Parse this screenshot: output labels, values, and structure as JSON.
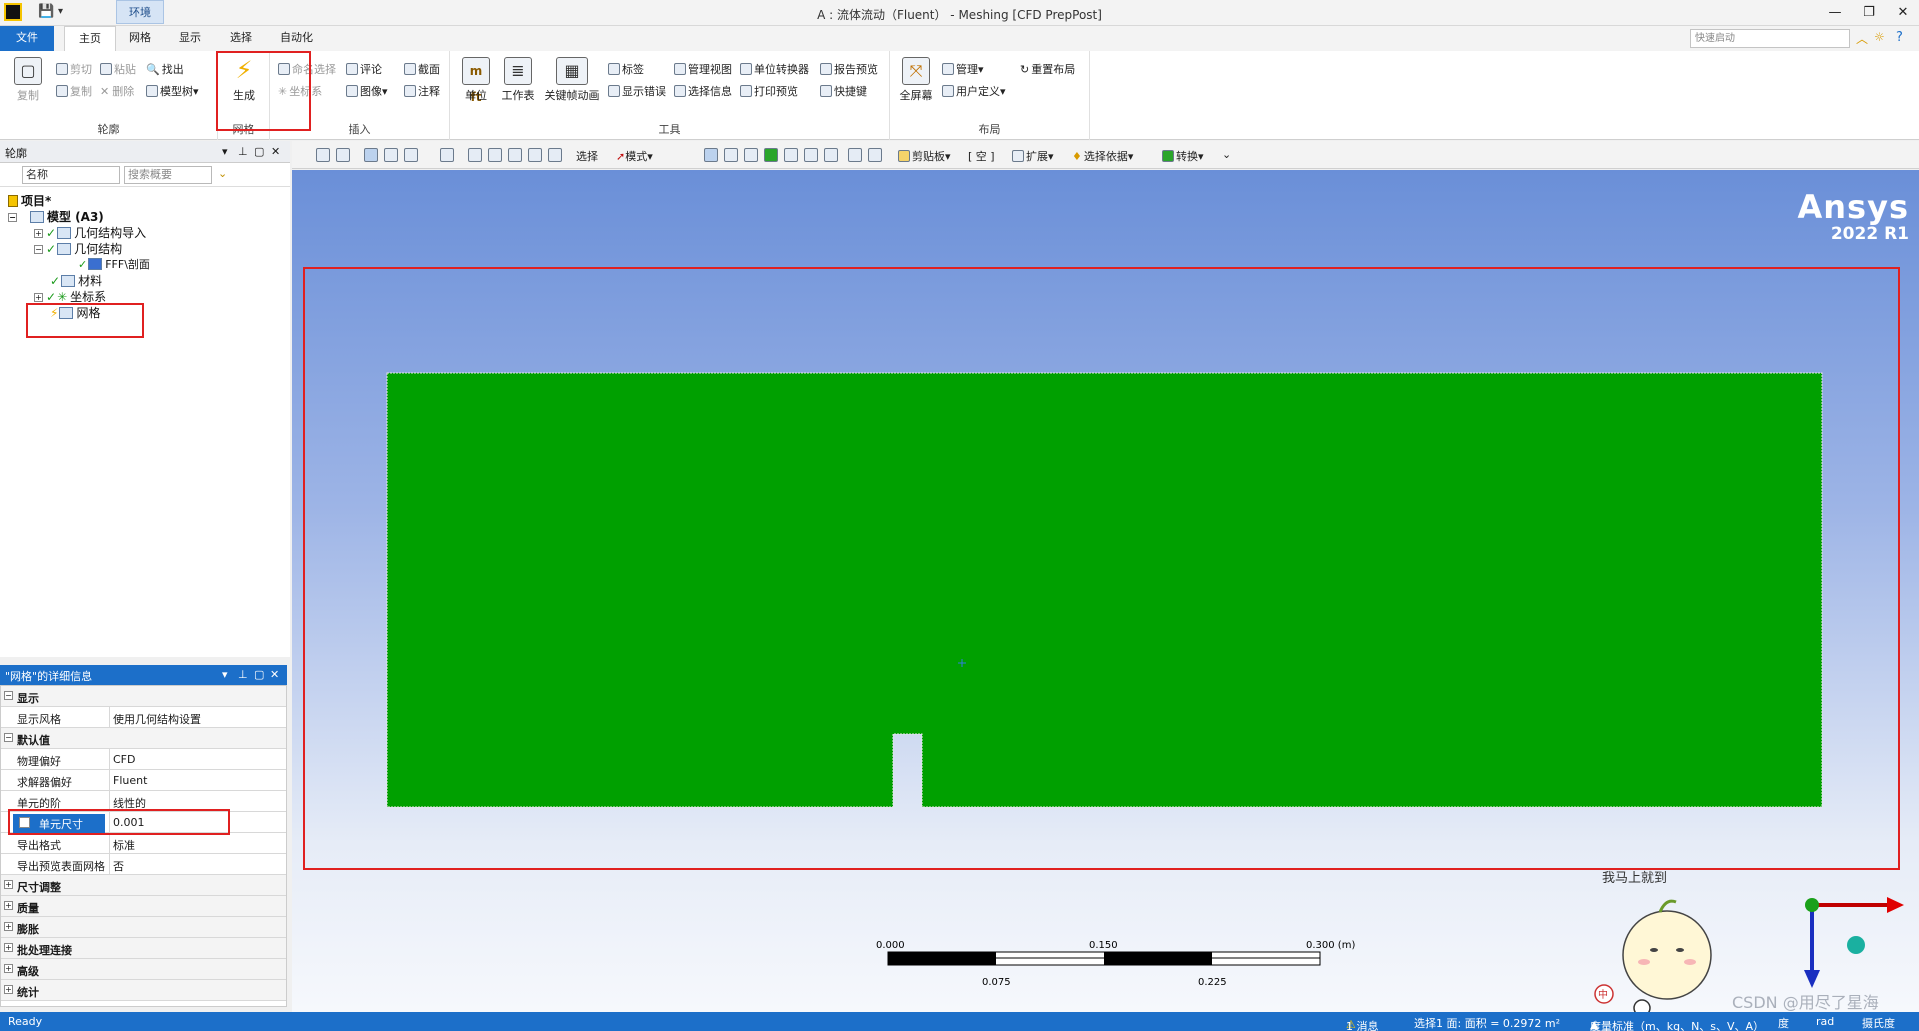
{
  "window": {
    "title": "A : 流体流动（Fluent） - Meshing [CFD PrepPost]",
    "context_tab": "环境",
    "controls": [
      "—",
      "❐",
      "✕"
    ]
  },
  "tabs": [
    {
      "label": "文件"
    },
    {
      "label": "主页"
    },
    {
      "label": "网格"
    },
    {
      "label": "显示"
    },
    {
      "label": "选择"
    },
    {
      "label": "自动化"
    }
  ],
  "search": {
    "placeholder": "快速启动"
  },
  "ribbon": {
    "outline": {
      "label": "轮廓",
      "copy_big": "复制",
      "cut": "剪切",
      "copy": "复制",
      "paste": "粘贴",
      "delete": "删除",
      "find": "找出",
      "tree": "模型树"
    },
    "mesh": {
      "label": "网格",
      "generate": "生成"
    },
    "insert": {
      "label": "插入",
      "named_sel": "命名选择",
      "coords": "坐标系",
      "comment": "评论",
      "image": "图像",
      "section": "截面",
      "annotation": "注释"
    },
    "tools": {
      "label": "工具",
      "units": "单位",
      "worksheet": "工作表",
      "keyframe": "关键帧动画",
      "tag": "标签",
      "show_err": "显示错误",
      "manage_view": "管理视图",
      "sel_info": "选择信息",
      "unit_conv": "单位转换器",
      "print_preview": "打印预览",
      "report_preview": "报告预览",
      "shortcuts": "快捷键"
    },
    "layout": {
      "label": "布局",
      "fullscreen": "全屏幕",
      "manage": "管理",
      "user_def": "用户定义",
      "reset": "重置布局"
    }
  },
  "outline": {
    "title": "轮廓",
    "filter_name": "名称",
    "filter_search": "搜索概要",
    "tree": {
      "project": "项目*",
      "model": "模型 (A3)",
      "geom_import": "几何结构导入",
      "geometry": "几何结构",
      "body": "FFF\\剖面",
      "materials": "材料",
      "coords": "坐标系",
      "mesh": "网格"
    }
  },
  "details": {
    "title": "\"网格\"的详细信息",
    "sections": {
      "display": "显示",
      "defaults": "默认值",
      "sizing": "尺寸调整",
      "quality": "质量",
      "inflation": "膨胀",
      "batch": "批处理连接",
      "advanced": "高级",
      "stats": "统计"
    },
    "rows": {
      "display_style": {
        "k": "显示风格",
        "v": "使用几何结构设置"
      },
      "physics": {
        "k": "物理偏好",
        "v": "CFD"
      },
      "solver": {
        "k": "求解器偏好",
        "v": "Fluent"
      },
      "element_order": {
        "k": "单元的阶",
        "v": "线性的"
      },
      "element_size": {
        "k": "单元尺寸",
        "v": "0.001"
      },
      "export_format": {
        "k": "导出格式",
        "v": "标准"
      },
      "export_preview": {
        "k": "导出预览表面网格",
        "v": "否"
      }
    }
  },
  "gtoolbar": {
    "select": "选择",
    "mode": "模式",
    "clipboard": "剪贴板",
    "empty": "[ 空 ]",
    "expand": "扩展",
    "select_by": "选择依据",
    "convert": "转换"
  },
  "viewport": {
    "brand": "Ansys",
    "version": "2022 R1",
    "geometry_color": "#00a000",
    "scale": {
      "top_labels": [
        "0.000",
        "0.150",
        "0.300 (m)"
      ],
      "bottom_labels": [
        "0.075",
        "0.225"
      ]
    },
    "mascot_text": "我马上就到",
    "mascot_badge": "中",
    "watermark": "CSDN @用尽了星海"
  },
  "status": {
    "ready": "Ready",
    "messages": "1 消息",
    "selection": "选择1 面: 面积 = 0.2972 m²",
    "units": "度量标准（m、kg、N、s、V、A）",
    "deg": "度",
    "rad": "rad",
    "celsius": "摄氏度"
  }
}
